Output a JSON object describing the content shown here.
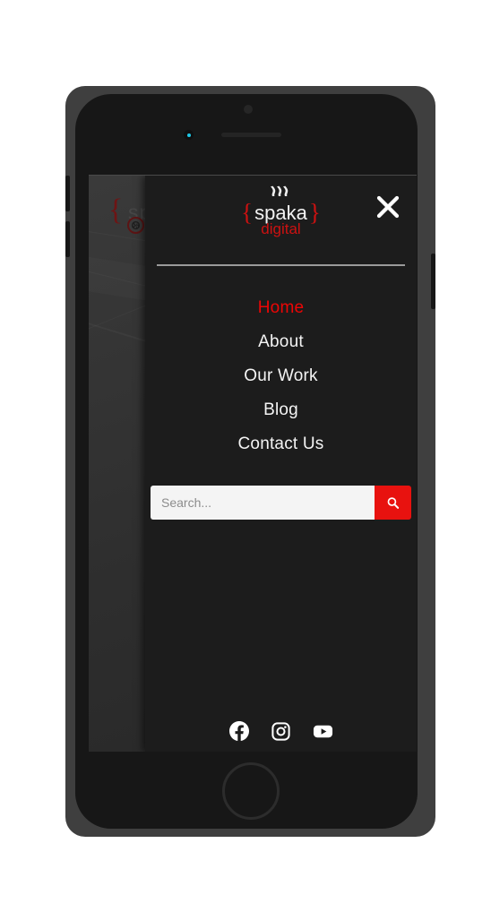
{
  "device": {
    "type": "smartphone-mockup",
    "frame_color": "#3f3f3f",
    "body_color": "#171717",
    "sensor_led_color": "#1ec8e8"
  },
  "background_page": {
    "brace": "{",
    "faded_logo_text": "sp",
    "aperture_icon_color": "#5c1414"
  },
  "drawer": {
    "background_color": "#1c1c1c",
    "brand": {
      "brace_left": "{",
      "name": "spaka",
      "brace_right": "}",
      "tagline": "digital",
      "name_color": "#f2f2f2",
      "accent_color": "#cc1111",
      "steam_icon": "steam-lines-icon"
    },
    "close_button": {
      "icon": "close-x-icon",
      "label": "Close menu",
      "color": "#ffffff"
    },
    "nav": {
      "active_color": "#ee0505",
      "items": [
        {
          "label": "Home",
          "active": true
        },
        {
          "label": "About",
          "active": false
        },
        {
          "label": "Our Work",
          "active": false
        },
        {
          "label": "Blog",
          "active": false
        },
        {
          "label": "Contact Us",
          "active": false
        }
      ]
    },
    "search": {
      "placeholder": "Search...",
      "value": "",
      "button_icon": "search-magnifier-icon",
      "button_color": "#e8120f",
      "field_background": "#f4f4f4"
    },
    "social": [
      {
        "name": "facebook",
        "icon": "facebook-icon",
        "label": "Facebook"
      },
      {
        "name": "instagram",
        "icon": "instagram-icon",
        "label": "Instagram"
      },
      {
        "name": "youtube",
        "icon": "youtube-icon",
        "label": "YouTube"
      }
    ]
  }
}
